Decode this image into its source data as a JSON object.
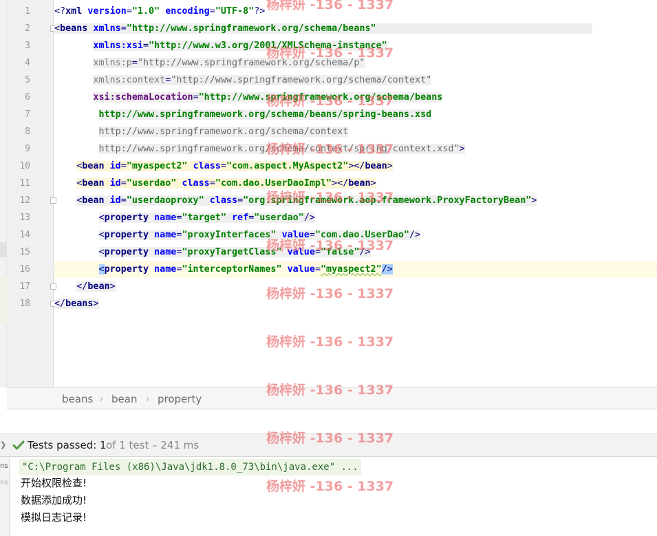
{
  "editor": {
    "line_numbers": [
      "1",
      "2",
      "3",
      "4",
      "5",
      "6",
      "7",
      "8",
      "9",
      "10",
      "11",
      "12",
      "13",
      "14",
      "15",
      "16",
      "17",
      "18"
    ],
    "lines": [
      [
        [
          "<?",
          "ptag"
        ],
        [
          "xml ",
          "tag"
        ],
        [
          "version",
          "attr"
        ],
        [
          "=",
          "ptag"
        ],
        [
          "\"1.0\"",
          "str"
        ],
        [
          " ",
          ""
        ],
        [
          "encoding",
          "attr"
        ],
        [
          "=",
          "ptag"
        ],
        [
          "\"UTF-8\"",
          "str"
        ],
        [
          "?>",
          "ptag"
        ]
      ],
      [
        [
          "<",
          "ptag"
        ],
        [
          "beans ",
          "tag"
        ],
        [
          "xmlns",
          "attr"
        ],
        [
          "=",
          "ptag"
        ],
        [
          "\"http://www.springframework.org/schema/beans\"",
          "str"
        ]
      ],
      [
        [
          "       ",
          ""
        ],
        [
          "xmlns:xsi",
          "attr"
        ],
        [
          "=",
          "ptag"
        ],
        [
          "\"http://www.w3.org/2001/XMLSchema-instance\"",
          "str"
        ]
      ],
      [
        [
          "       ",
          ""
        ],
        [
          "xmlns:p",
          "gattr"
        ],
        [
          "=",
          "ptag"
        ],
        [
          "\"http://www.springframework.org/schema/p\"",
          "gstr"
        ]
      ],
      [
        [
          "       ",
          ""
        ],
        [
          "xmlns:context",
          "gattr"
        ],
        [
          "=",
          "ptag"
        ],
        [
          "\"http://www.springframework.org/schema/context\"",
          "gstr"
        ]
      ],
      [
        [
          "       ",
          ""
        ],
        [
          "xsi:schemaLocation",
          "pattr"
        ],
        [
          "=",
          "ptag"
        ],
        [
          "\"http://www.springframework.org/schema/beans",
          "str"
        ]
      ],
      [
        [
          "        ",
          ""
        ],
        [
          "http://www.springframework.org/schema/beans/spring-beans.xsd",
          "str"
        ]
      ],
      [
        [
          "        ",
          ""
        ],
        [
          "http://www.springframework.org/schema/context",
          "gstr"
        ]
      ],
      [
        [
          "        ",
          ""
        ],
        [
          "http://www.springframework.org/schema/context/spring-context.xsd\"",
          "gstr"
        ],
        [
          ">",
          "ptag"
        ]
      ],
      [
        [
          "    ",
          ""
        ],
        [
          "<",
          "ptag"
        ],
        [
          "bean ",
          "tag"
        ],
        [
          "id",
          "attr"
        ],
        [
          "=",
          "ptag"
        ],
        [
          "\"myaspect2\"",
          "str"
        ],
        [
          " ",
          ""
        ],
        [
          "class",
          "attr"
        ],
        [
          "=",
          "ptag"
        ],
        [
          "\"com.aspect.MyAspect2\"",
          "str"
        ],
        [
          "></",
          "ptag"
        ],
        [
          "bean",
          "tag"
        ],
        [
          ">",
          "ptag"
        ]
      ],
      [
        [
          "    ",
          ""
        ],
        [
          "<",
          "ptag"
        ],
        [
          "bean ",
          "tag"
        ],
        [
          "id",
          "attr"
        ],
        [
          "=",
          "ptag"
        ],
        [
          "\"userdao\"",
          "str"
        ],
        [
          " ",
          ""
        ],
        [
          "class",
          "attr"
        ],
        [
          "=",
          "ptag"
        ],
        [
          "\"com.dao.UserDaoImpl\"",
          "str"
        ],
        [
          "></",
          "ptag"
        ],
        [
          "bean",
          "tag"
        ],
        [
          ">",
          "ptag"
        ]
      ],
      [
        [
          "    ",
          ""
        ],
        [
          "<",
          "ptag"
        ],
        [
          "bean ",
          "tag"
        ],
        [
          "id",
          "attr"
        ],
        [
          "=",
          "ptag"
        ],
        [
          "\"userdaoproxy\"",
          "str"
        ],
        [
          " ",
          ""
        ],
        [
          "class",
          "attr"
        ],
        [
          "=",
          "ptag"
        ],
        [
          "\"org.springframework.aop.framework.ProxyFactoryBean\"",
          "str"
        ],
        [
          ">",
          "ptag"
        ]
      ],
      [
        [
          "        ",
          ""
        ],
        [
          "<",
          "ptag"
        ],
        [
          "property ",
          "tag"
        ],
        [
          "name",
          "attr"
        ],
        [
          "=",
          "ptag"
        ],
        [
          "\"target\"",
          "str"
        ],
        [
          " ",
          ""
        ],
        [
          "ref",
          "attr"
        ],
        [
          "=",
          "ptag"
        ],
        [
          "\"userdao\"",
          "str"
        ],
        [
          "/>",
          "ptag"
        ]
      ],
      [
        [
          "        ",
          ""
        ],
        [
          "<",
          "ptag"
        ],
        [
          "property ",
          "tag"
        ],
        [
          "name",
          "attr"
        ],
        [
          "=",
          "ptag"
        ],
        [
          "\"proxyInterfaces\"",
          "str"
        ],
        [
          " ",
          ""
        ],
        [
          "value",
          "attr"
        ],
        [
          "=",
          "ptag"
        ],
        [
          "\"com.dao.UserDao\"",
          "str"
        ],
        [
          "/>",
          "ptag"
        ]
      ],
      [
        [
          "        ",
          ""
        ],
        [
          "<",
          "ptag"
        ],
        [
          "property ",
          "tag"
        ],
        [
          "name",
          "attr"
        ],
        [
          "=",
          "ptag"
        ],
        [
          "\"proxyTargetClass\"",
          "str"
        ],
        [
          " ",
          ""
        ],
        [
          "value",
          "attr"
        ],
        [
          "=",
          "ptag"
        ],
        [
          "\"false\"",
          "str"
        ],
        [
          "/>",
          "ptag"
        ]
      ],
      [
        [
          "        ",
          ""
        ],
        [
          "<",
          "ptag cursor"
        ],
        [
          "property ",
          "tag"
        ],
        [
          "name",
          "attr"
        ],
        [
          "=",
          "ptag"
        ],
        [
          "\"interceptorNames\"",
          "str"
        ],
        [
          " ",
          ""
        ],
        [
          "value",
          "attr"
        ],
        [
          "=",
          "ptag"
        ],
        [
          "\"myaspect2\"",
          "str squig"
        ],
        [
          "/>",
          "ptag cursor"
        ]
      ],
      [
        [
          "    ",
          ""
        ],
        [
          "</",
          "ptag"
        ],
        [
          "bean",
          "tag"
        ],
        [
          ">",
          "ptag"
        ]
      ],
      [
        [
          "</",
          "ptag"
        ],
        [
          "beans",
          "tag"
        ],
        [
          ">",
          "ptag"
        ]
      ]
    ]
  },
  "breadcrumb": {
    "items": [
      "beans",
      "bean",
      "property"
    ],
    "separator": "›"
  },
  "tests": {
    "passed_label": "Tests passed: ",
    "passed_count": "1",
    "total_text": " of 1 test – 241 ms"
  },
  "console": {
    "side_label_1": "ns",
    "side_label_2": "ns",
    "command": "\"C:\\Program Files (x86)\\Java\\jdk1.8.0_73\\bin\\java.exe\" ...",
    "output": [
      "开始权限检查!",
      "数据添加成功!",
      "模拟日志记录!"
    ]
  },
  "watermark": {
    "text": "杨梓妍 -136 - 1337"
  },
  "colors": {
    "tag": "#000080",
    "attribute": "#0000ff",
    "string": "#008000",
    "pass_green": "#4e9a3e",
    "watermark": "#ec6464"
  }
}
